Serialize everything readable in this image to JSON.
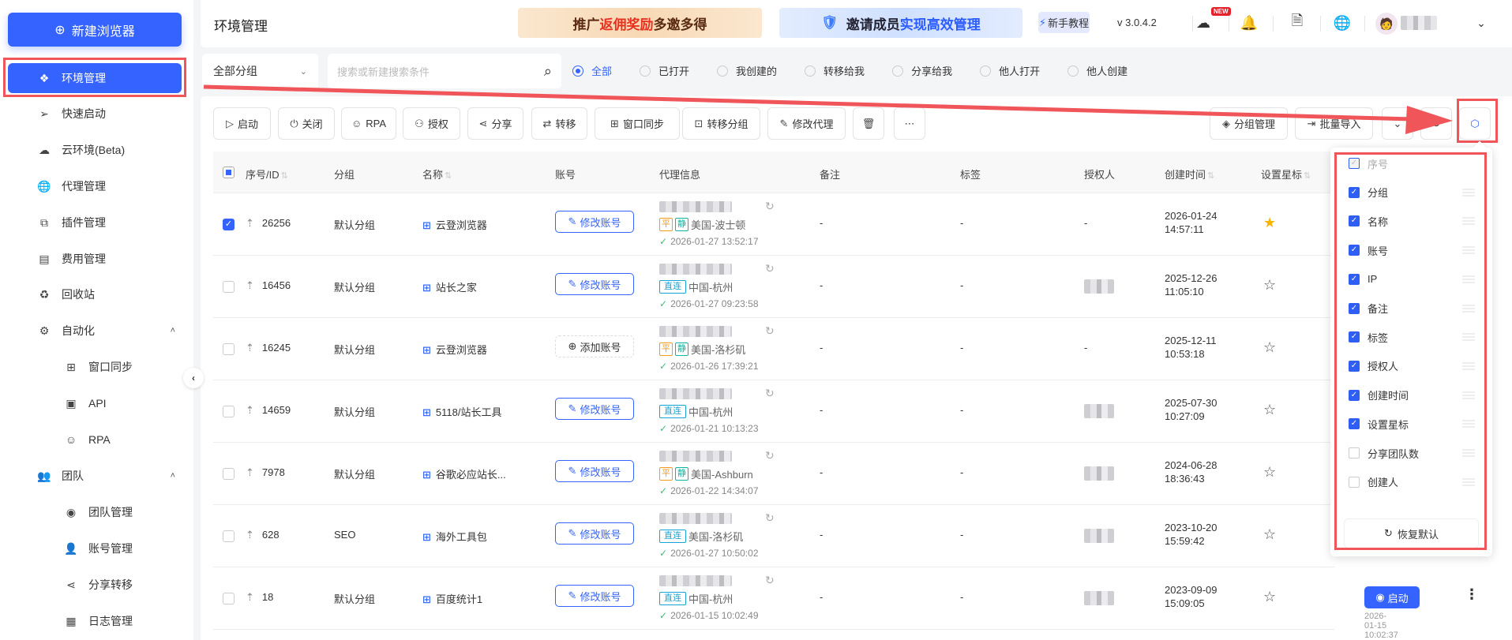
{
  "sidebar": {
    "new_browser": "新建浏览器",
    "items": [
      {
        "label": "环境管理",
        "icon": "cluster-icon",
        "glyph": "❖",
        "active": true
      },
      {
        "label": "快速启动",
        "icon": "send-icon",
        "glyph": "➢"
      },
      {
        "label": "云环境(Beta)",
        "icon": "cloud-icon",
        "glyph": "☁"
      },
      {
        "label": "代理管理",
        "icon": "globe-icon",
        "glyph": "🌐"
      },
      {
        "label": "插件管理",
        "icon": "plugin-icon",
        "glyph": "⧉"
      },
      {
        "label": "费用管理",
        "icon": "billing-icon",
        "glyph": "▤"
      },
      {
        "label": "回收站",
        "icon": "recycle-icon",
        "glyph": "♻"
      },
      {
        "label": "自动化",
        "icon": "automation-icon",
        "glyph": "⚙",
        "expand": "˄"
      },
      {
        "label": "窗口同步",
        "icon": "window-sync-icon",
        "glyph": "⊞",
        "sub": true
      },
      {
        "label": "API",
        "icon": "api-icon",
        "glyph": "▣",
        "sub": true
      },
      {
        "label": "RPA",
        "icon": "robot-icon",
        "glyph": "☺",
        "sub": true
      },
      {
        "label": "团队",
        "icon": "team-icon",
        "glyph": "👥",
        "expand": "˄"
      },
      {
        "label": "团队管理",
        "icon": "team-manage-icon",
        "glyph": "◉",
        "sub": true
      },
      {
        "label": "账号管理",
        "icon": "user-icon",
        "glyph": "👤",
        "sub": true
      },
      {
        "label": "分享转移",
        "icon": "share-icon",
        "glyph": "⋖",
        "sub": true
      },
      {
        "label": "日志管理",
        "icon": "log-icon",
        "glyph": "▦",
        "sub": true
      }
    ]
  },
  "header": {
    "title": "环境管理",
    "banner1": {
      "a": "推广",
      "b": "返佣奖励",
      "c": " 多邀多得"
    },
    "banner2": {
      "a": "邀请成员 ",
      "b": "实现高效管理"
    },
    "tutorial": "新手教程",
    "version": "v 3.0.4.2",
    "new_badge": "NEW"
  },
  "filter": {
    "group_select": "全部分组",
    "search_placeholder": "搜索或新建搜索条件",
    "radios": [
      {
        "label": "全部",
        "checked": true
      },
      {
        "label": "已打开"
      },
      {
        "label": "我创建的"
      },
      {
        "label": "转移给我"
      },
      {
        "label": "分享给我"
      },
      {
        "label": "他人打开"
      },
      {
        "label": "他人创建"
      }
    ]
  },
  "toolbar": {
    "left": [
      {
        "label": "启动",
        "glyph": "▷",
        "icon": "play-icon"
      },
      {
        "label": "关闭",
        "glyph": "⏻",
        "icon": "power-icon"
      },
      {
        "label": "RPA",
        "glyph": "☺",
        "icon": "robot-icon"
      },
      {
        "label": "授权",
        "glyph": "⚇",
        "icon": "authorize-icon"
      },
      {
        "label": "分享",
        "glyph": "⋖",
        "icon": "share-icon"
      },
      {
        "label": "转移",
        "glyph": "⇄",
        "icon": "transfer-icon"
      },
      {
        "label": "窗口同步",
        "glyph": "⊞",
        "icon": "window-sync-icon"
      },
      {
        "label": "转移分组",
        "glyph": "⊡",
        "icon": "move-group-icon"
      },
      {
        "label": "修改代理",
        "glyph": "✎",
        "icon": "edit-proxy-icon"
      },
      {
        "label": "",
        "glyph": "🗑",
        "icon": "delete-icon"
      },
      {
        "label": "",
        "glyph": "⋯",
        "icon": "more-icon"
      }
    ],
    "right": [
      {
        "label": "分组管理",
        "glyph": "◈",
        "icon": "layers-icon"
      },
      {
        "label": "批量导入",
        "glyph": "⇥",
        "icon": "import-icon"
      },
      {
        "label": "",
        "glyph": "⌄",
        "icon": "chevron-down-icon"
      },
      {
        "label": "",
        "glyph": "↻",
        "icon": "refresh-icon"
      },
      {
        "label": "",
        "glyph": "⬡",
        "icon": "column-settings-icon"
      }
    ]
  },
  "table": {
    "columns": {
      "id": "序号/ID",
      "group": "分组",
      "name": "名称",
      "account": "账号",
      "proxy": "代理信息",
      "note": "备注",
      "tag": "标签",
      "auth": "授权人",
      "created": "创建时间",
      "star": "设置星标"
    },
    "rows": [
      {
        "checked": true,
        "id": "26256",
        "group": "默认分组",
        "name": "云登浏览器",
        "account_action": "修改账号",
        "tags": [
          "平",
          "静"
        ],
        "location": "美国-波士顿",
        "proxy_time": "2026-01-27 13:52:17",
        "note": "-",
        "tag": "-",
        "auth": "-",
        "created_date": "2026-01-24",
        "created_time": "14:57:11",
        "starred": true
      },
      {
        "id": "16456",
        "group": "默认分组",
        "name": "站长之家",
        "account_action": "修改账号",
        "tags": [
          "直连"
        ],
        "location": "中国-杭州",
        "proxy_time": "2026-01-27 09:23:58",
        "note": "-",
        "tag": "-",
        "created_date": "2025-12-26",
        "created_time": "11:05:10"
      },
      {
        "id": "16245",
        "group": "默认分组",
        "name": "云登浏览器",
        "account_action": "添加账号",
        "add": true,
        "tags": [
          "平",
          "静"
        ],
        "location": "美国-洛杉矶",
        "proxy_time": "2026-01-26 17:39:21",
        "note": "-",
        "tag": "-",
        "auth": "-",
        "created_date": "2025-12-11",
        "created_time": "10:53:18"
      },
      {
        "id": "14659",
        "group": "默认分组",
        "name": "5118/站长工具",
        "account_action": "修改账号",
        "tags": [
          "直连"
        ],
        "location": "中国-杭州",
        "proxy_time": "2026-01-21 10:13:23",
        "note": "-",
        "tag": "-",
        "created_date": "2025-07-30",
        "created_time": "10:27:09"
      },
      {
        "id": "7978",
        "group": "默认分组",
        "name": "谷歌必应站长...",
        "account_action": "修改账号",
        "tags": [
          "平",
          "静"
        ],
        "location": "美国-Ashburn",
        "proxy_time": "2026-01-22 14:34:07",
        "note": "-",
        "tag": "-",
        "created_date": "2024-06-28",
        "created_time": "18:36:43"
      },
      {
        "id": "628",
        "group": "SEO",
        "name": "海外工具包",
        "account_action": "修改账号",
        "tags": [
          "直连"
        ],
        "location": "美国-洛杉矶",
        "proxy_time": "2026-01-27 10:50:02",
        "note": "-",
        "tag": "-",
        "created_date": "2023-10-20",
        "created_time": "15:59:42"
      },
      {
        "id": "18",
        "group": "默认分组",
        "name": "百度统计1",
        "account_action": "修改账号",
        "tags": [
          "直连"
        ],
        "location": "中国-杭州",
        "proxy_time": "2026-01-15 10:02:49",
        "note": "-",
        "tag": "-",
        "created_date": "2023-09-09",
        "created_time": "15:09:05",
        "launch": "启动",
        "launch_time": "2026-01-15 10:02:37"
      }
    ]
  },
  "column_popover": {
    "items": [
      {
        "label": "序号",
        "checked": true,
        "disabled": true
      },
      {
        "label": "分组",
        "checked": true
      },
      {
        "label": "名称",
        "checked": true
      },
      {
        "label": "账号",
        "checked": true
      },
      {
        "label": "IP",
        "checked": true
      },
      {
        "label": "备注",
        "checked": true
      },
      {
        "label": "标签",
        "checked": true
      },
      {
        "label": "授权人",
        "checked": true
      },
      {
        "label": "创建时间",
        "checked": true
      },
      {
        "label": "设置星标",
        "checked": true
      },
      {
        "label": "分享团队数",
        "checked": false
      },
      {
        "label": "创建人",
        "checked": false
      }
    ],
    "restore": "恢复默认"
  },
  "colors": {
    "primary": "#3563ff",
    "annotation": "#f0555a",
    "star": "#f7b500"
  }
}
